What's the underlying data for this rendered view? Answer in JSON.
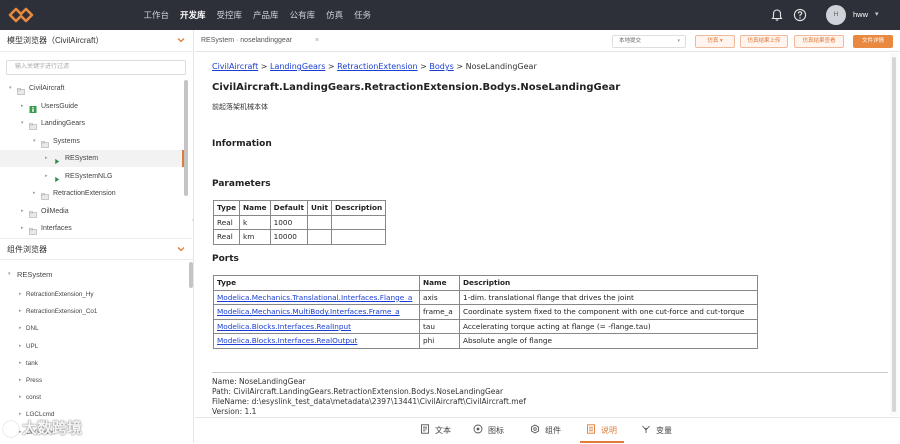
{
  "topnav": {
    "items": [
      "工作台",
      "开发库",
      "受控库",
      "产品库",
      "公有库",
      "仿真",
      "任务"
    ],
    "active_index": 1
  },
  "user": {
    "avatar_initial": "H",
    "name": "hww"
  },
  "model_browser": {
    "title": "模型浏览器（CivilAircraft）",
    "search_placeholder": "输入关键字进行过滤",
    "tree": [
      {
        "label": "CivilAircraft",
        "level": 0,
        "expanded": true,
        "icon": "package-icon"
      },
      {
        "label": "UsersGuide",
        "level": 1,
        "expanded": false,
        "icon": "info-icon"
      },
      {
        "label": "LandingGears",
        "level": 1,
        "expanded": true,
        "icon": "package-icon"
      },
      {
        "label": "Systems",
        "level": 2,
        "expanded": true,
        "icon": "package-icon"
      },
      {
        "label": "RESystem",
        "level": 3,
        "expanded": false,
        "icon": "model-icon",
        "selected": true
      },
      {
        "label": "RESystemNLG",
        "level": 3,
        "expanded": false,
        "icon": "model-icon"
      },
      {
        "label": "RetractionExtension",
        "level": 2,
        "expanded": false,
        "icon": "package-icon"
      },
      {
        "label": "OilMedia",
        "level": 1,
        "expanded": false,
        "icon": "package-icon"
      },
      {
        "label": "Interfaces",
        "level": 1,
        "expanded": false,
        "icon": "package-icon"
      }
    ]
  },
  "component_browser": {
    "title": "组件浏览器",
    "root": "RESystem",
    "items": [
      "RetractionExtension_Hy",
      "RetractionExtension_Co1",
      "DNL",
      "UPL",
      "tank",
      "Press",
      "const",
      "LGCLcmd",
      "OnGround"
    ]
  },
  "tabbar": {
    "tab_label": "RESystem · noselandinggear",
    "tab_close": "×",
    "select_value": "本地提交",
    "buttons": [
      "仿真",
      "仿真结果上传",
      "仿真结果查看",
      "文件详情"
    ]
  },
  "doc": {
    "breadcrumb": [
      "CivilAircraft",
      "LandingGears",
      "RetractionExtension",
      "Bodys"
    ],
    "breadcrumb_sep": " > ",
    "breadcrumb_current": "NoseLandingGear",
    "title": "CivilAircraft.LandingGears.RetractionExtension.Bodys.NoseLandingGear",
    "description": "前起落架机械本体",
    "information_heading": "Information",
    "parameters_heading": "Parameters",
    "parameters": {
      "columns": [
        "Type",
        "Name",
        "Default",
        "Unit",
        "Description"
      ],
      "rows": [
        [
          "Real",
          "k",
          "1000",
          "",
          ""
        ],
        [
          "Real",
          "km",
          "10000",
          "",
          ""
        ]
      ]
    },
    "ports_heading": "Ports",
    "ports": {
      "columns": [
        "Type",
        "Name",
        "Description"
      ],
      "rows": [
        [
          "Modelica.Mechanics.Translational.Interfaces.Flange_a",
          "axis",
          "1-dim. translational flange that drives the joint"
        ],
        [
          "Modelica.Mechanics.MultiBody.Interfaces.Frame_a",
          "frame_a",
          "Coordinate system fixed to the component with one cut-force and cut-torque"
        ],
        [
          "Modelica.Blocks.Interfaces.RealInput",
          "tau",
          "Accelerating torque acting at flange (= -flange.tau)"
        ],
        [
          "Modelica.Blocks.Interfaces.RealOutput",
          "phi",
          "Absolute angle of flange"
        ]
      ]
    },
    "meta": [
      "Name: NoseLandingGear",
      "Path: CivilAircraft.LandingGears.RetractionExtension.Bodys.NoseLandingGear",
      "FileName: d:\\esyslink_test_data\\metadata\\2397\\13441\\CivilAircraft\\CivilAircraft.mef",
      "Version: 1.1"
    ]
  },
  "bottom_tabs": [
    {
      "label": "文本",
      "icon": "text-icon"
    },
    {
      "label": "图标",
      "icon": "image-icon"
    },
    {
      "label": "组件",
      "icon": "component-icon"
    },
    {
      "label": "说明",
      "icon": "doc-icon",
      "active": true
    },
    {
      "label": "变量",
      "icon": "variable-icon"
    }
  ],
  "watermark": "大数跨境",
  "colors": {
    "topbar": "#2d3038",
    "accent": "#e07b39",
    "link": "#1a3ed4"
  }
}
